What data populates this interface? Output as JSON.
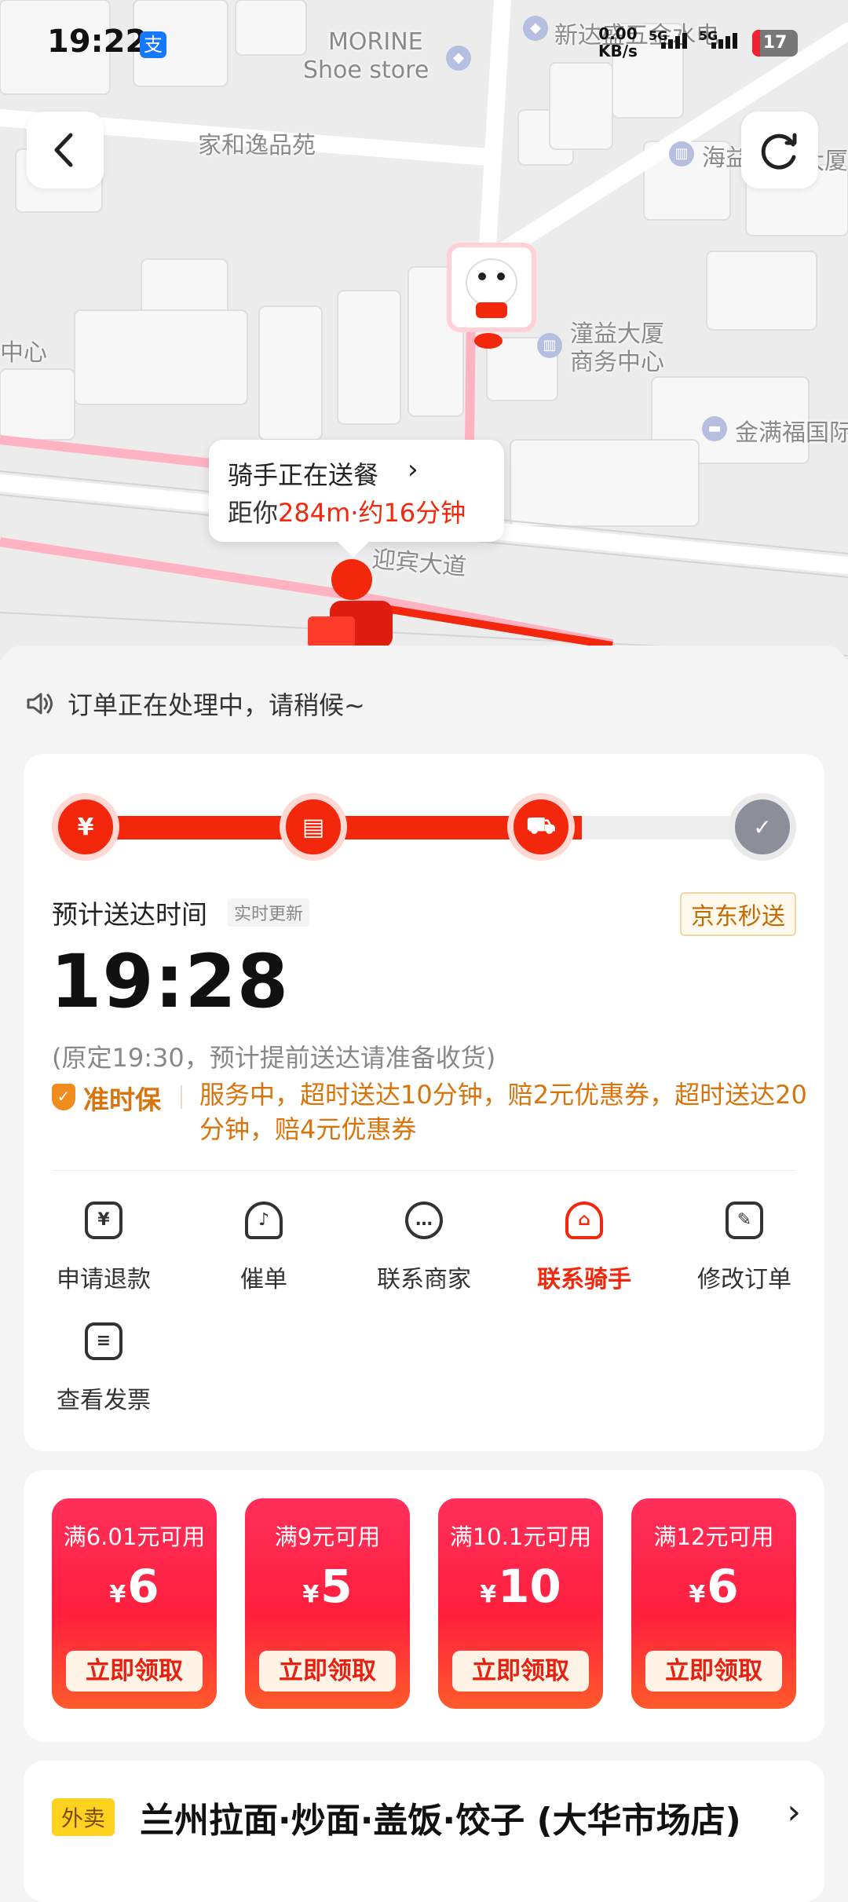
{
  "status_bar": {
    "time": "19:22",
    "alipay_icon": "支",
    "net_speed_value": "0.00",
    "net_speed_unit": "KB/s",
    "signal_1": "5G",
    "signal_2": "5G",
    "battery": "17"
  },
  "map": {
    "labels": {
      "morine": "MORINE",
      "shoe_store": "Shoe store",
      "xinda": "新达盛五金水电",
      "jiahe": "家和逸品苑",
      "hai": "海益",
      "dasha": "大厦",
      "zhongxin": "中心",
      "tongyi_1": "潼益大厦",
      "tongyi_2": "商务中心",
      "jinman": "金满福国际",
      "road": "迎宾大道"
    },
    "rider_bubble": {
      "title": "骑手正在送餐",
      "prefix": "距你",
      "distance": "284m·约16分钟"
    }
  },
  "notice": {
    "text": "订单正在处理中，请稍候~"
  },
  "order": {
    "progress_fraction": 0.72,
    "steps": [
      {
        "icon": "yuan-icon",
        "glyph": "¥"
      },
      {
        "icon": "store-icon",
        "glyph": "▤"
      },
      {
        "icon": "scooter-icon",
        "glyph": "⛟"
      },
      {
        "icon": "check-icon",
        "glyph": "✓"
      }
    ],
    "eta_label": "预计送达时间",
    "eta_tag": "实时更新",
    "brand_badge": "京东秒送",
    "eta_time": "19:28",
    "eta_note": "(原定19:30，预计提前送达请准备收货)",
    "guarantee_title": "准时保",
    "guarantee_text": "服务中，超时送达10分钟，赔2元优惠券，超时送达20分钟，赔4元优惠券",
    "actions": [
      {
        "label": "申请退款",
        "icon": "refund-icon",
        "glyph": "¥"
      },
      {
        "label": "催单",
        "icon": "bell-icon",
        "glyph": "♪"
      },
      {
        "label": "联系商家",
        "icon": "merchant-chat-icon",
        "glyph": "…"
      },
      {
        "label": "联系骑手",
        "icon": "rider-helmet-icon",
        "glyph": "⌂"
      },
      {
        "label": "修改订单",
        "icon": "edit-order-icon",
        "glyph": "✎"
      },
      {
        "label": "查看发票",
        "icon": "invoice-icon",
        "glyph": "≡"
      }
    ]
  },
  "coupons": [
    {
      "condition": "满6.01元可用",
      "currency": "¥",
      "amount": "6",
      "claim": "立即领取"
    },
    {
      "condition": "满9元可用",
      "currency": "¥",
      "amount": "5",
      "claim": "立即领取"
    },
    {
      "condition": "满10.1元可用",
      "currency": "¥",
      "amount": "10",
      "claim": "立即领取"
    },
    {
      "condition": "满12元可用",
      "currency": "¥",
      "amount": "6",
      "claim": "立即领取"
    }
  ],
  "store": {
    "tag": "外卖",
    "name": "兰州拉面·炒面·盖饭·饺子 (大华市场店)"
  },
  "colors": {
    "accent": "#f2270c",
    "guarantee": "#d9730b",
    "brand_badge": "#c36b00"
  }
}
